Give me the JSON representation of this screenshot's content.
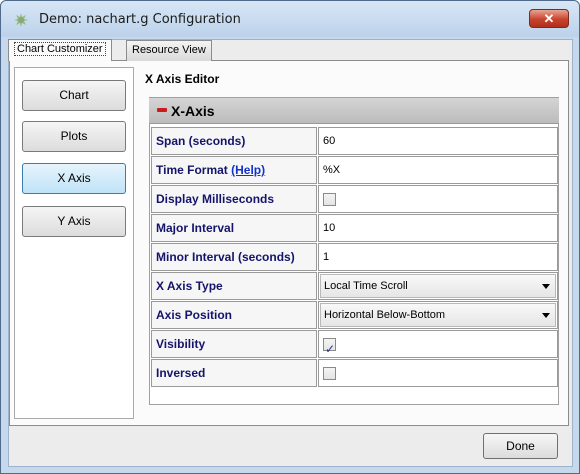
{
  "window": {
    "title": "Demo: nachart.g Configuration",
    "close_label": "✕"
  },
  "tabs": [
    {
      "label": "Chart Customizer",
      "active": true
    },
    {
      "label": "Resource View",
      "active": false
    }
  ],
  "sidebar": {
    "items": [
      {
        "label": "Chart",
        "active": false
      },
      {
        "label": "Plots",
        "active": false
      },
      {
        "label": "X Axis",
        "active": true
      },
      {
        "label": "Y Axis",
        "active": false
      }
    ]
  },
  "editor": {
    "title": "X Axis Editor",
    "section_title": "X-Axis",
    "properties": {
      "span": {
        "label": "Span (seconds)",
        "value": "60"
      },
      "time_format": {
        "label": "Time Format",
        "help_link": "(Help)",
        "value": "%X"
      },
      "display_ms": {
        "label": "Display Milliseconds",
        "checked": false
      },
      "major_interval": {
        "label": "Major Interval",
        "value": "10"
      },
      "minor_interval": {
        "label": "Minor Interval (seconds)",
        "value": "1"
      },
      "axis_type": {
        "label": "X Axis Type",
        "value": "Local Time Scroll"
      },
      "axis_position": {
        "label": "Axis Position",
        "value": "Horizontal Below-Bottom"
      },
      "visibility": {
        "label": "Visibility",
        "checked": true
      },
      "inversed": {
        "label": "Inversed",
        "checked": false
      }
    }
  },
  "footer": {
    "done_label": "Done"
  },
  "colors": {
    "label_text": "#14146b",
    "link": "#1133cc",
    "active_nav": "#bfe3f7",
    "close_button": "#c8432e"
  }
}
